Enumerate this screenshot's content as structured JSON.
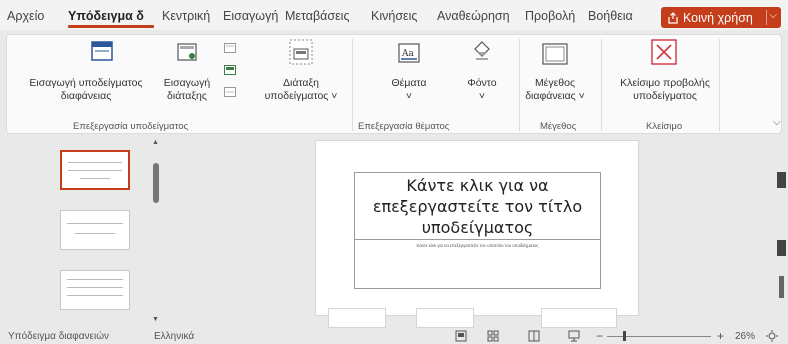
{
  "tabs": [
    {
      "label": "Αρχείο"
    },
    {
      "label": "Υπόδειγμα δ"
    },
    {
      "label": "Κεντρική"
    },
    {
      "label": "Εισαγωγή"
    },
    {
      "label": "Μεταβάσεις"
    },
    {
      "label": "Κινήσεις"
    },
    {
      "label": "Αναθεώρηση"
    },
    {
      "label": "Προβολή"
    },
    {
      "label": "Βοήθεια"
    }
  ],
  "share_button": {
    "label": "Κοινή χρήση",
    "icon": "share-icon"
  },
  "ribbon": {
    "buttons": {
      "insert_master": {
        "line1": "Εισαγωγή υποδείγματος",
        "line2": "διαφάνειας",
        "icon": "slide-master-icon"
      },
      "insert_layout": {
        "line1": "Εισαγωγή",
        "line2": "διάταξης",
        "icon": "insert-layout-icon"
      },
      "master_layout": {
        "line1": "Διάταξη",
        "line2": "υποδείγματος ˅",
        "icon": "master-layout-icon"
      },
      "themes": {
        "line1": "Θέματα",
        "line2": "˅",
        "icon": "themes-icon"
      },
      "background": {
        "line1": "Φόντο",
        "line2": "˅",
        "icon": "background-icon"
      },
      "slide_size": {
        "line1": "Μέγεθος",
        "line2": "διαφάνειας ˅",
        "icon": "slide-size-icon"
      },
      "close_master": {
        "line1": "Κλείσιμο προβολής",
        "line2": "υποδείγματος",
        "icon": "close-master-icon"
      }
    },
    "groups": [
      {
        "label": "Επεξεργασία υποδείγματος"
      },
      {
        "label": "Επεξεργασία θέματος"
      },
      {
        "label": "Μέγεθος"
      },
      {
        "label": "Κλείσιμο"
      }
    ],
    "collapse_icon": "chevron-down-icon"
  },
  "slide": {
    "title": "Κάντε κλικ για να επεξεργαστείτε τον τίτλο υποδείγματος",
    "subtitle": "Κάντε κλικ για να επεξεργαστείτε τον υπότιτλο του υποδείγματος"
  },
  "status_bar": {
    "view_label": "Υπόδειγμα διαφανειών",
    "language": "Ελληνικά",
    "zoom_minus": "−",
    "zoom_plus": "+",
    "zoom_level": "26%"
  },
  "colors": {
    "accent": "#c43e1c"
  }
}
